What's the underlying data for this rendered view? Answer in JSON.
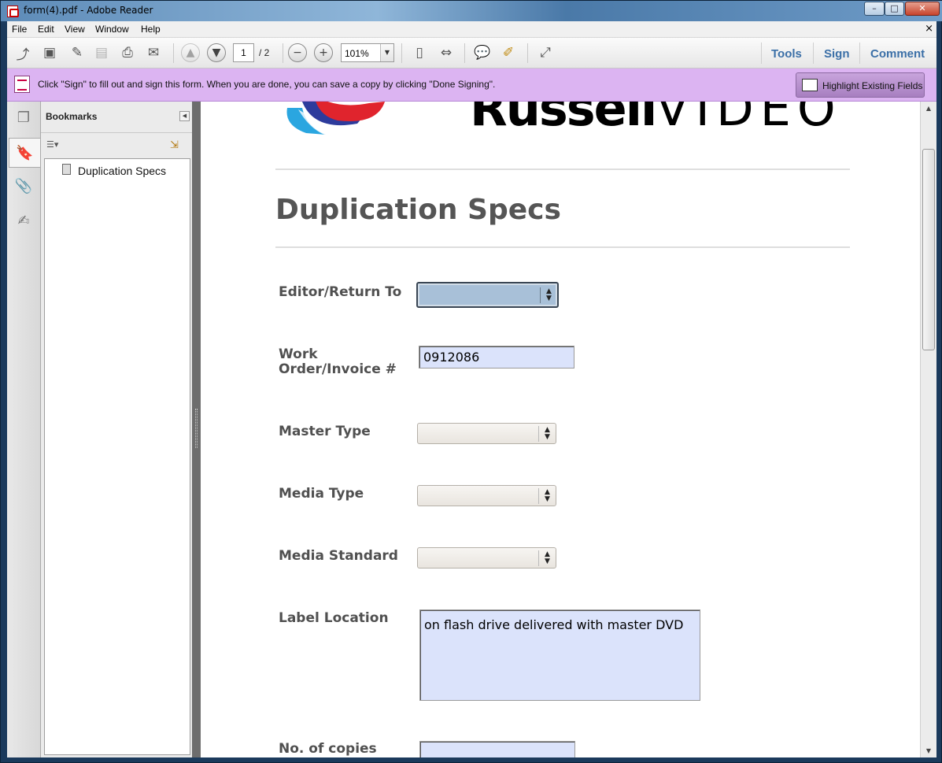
{
  "window": {
    "title": "form(4).pdf - Adobe Reader",
    "controls": {
      "minimize": "–",
      "maximize": "□",
      "close": "✕"
    }
  },
  "menubar": {
    "items": [
      "File",
      "Edit",
      "View",
      "Window",
      "Help"
    ],
    "close_doc": "×"
  },
  "toolbar": {
    "current_page": "1",
    "total_pages": "/ 2",
    "zoom": "101%",
    "tools_label": "Tools",
    "sign_label": "Sign",
    "comment_label": "Comment"
  },
  "banner": {
    "message": "Click \"Sign\" to fill out and sign this form. When you are done, you can save a copy by clicking \"Done Signing\".",
    "highlight_label": "Highlight Existing Fields",
    "color": "#dcb4f2"
  },
  "bookmarks": {
    "title": "Bookmarks",
    "items": [
      {
        "label": "Duplication Specs"
      }
    ]
  },
  "document": {
    "logo_text_bold": "Russell",
    "logo_text_thin": "VIDEO",
    "title": "Duplication Specs",
    "fields": {
      "editor_label": "Editor/Return To",
      "editor_value": "",
      "work_order_label_1": "Work",
      "work_order_label_2": "Order/Invoice #",
      "work_order_value": "0912086",
      "master_type_label": "Master Type",
      "master_type_value": "",
      "media_type_label": "Media Type",
      "media_type_value": "",
      "media_standard_label": "Media Standard",
      "media_standard_value": "",
      "label_location_label": "Label Location",
      "label_location_value": "on flash drive delivered with master DVD",
      "copies_label": "No. of copies",
      "copies_value": ""
    }
  },
  "colors": {
    "accent_link": "#3b6fa7",
    "field_fill": "#dbe3fb",
    "focused_combo": "#a8c0d8",
    "title_gray": "#555555"
  }
}
